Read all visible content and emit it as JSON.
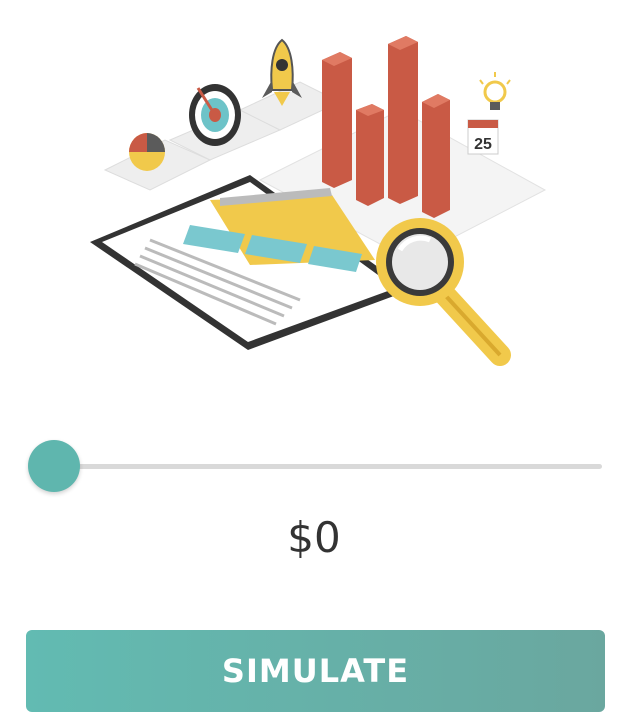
{
  "illustration": {
    "icon": "analytics-illustration",
    "calendar_day": "25"
  },
  "slider": {
    "value": 0,
    "min": 0
  },
  "amount_display": "$0",
  "simulate_button_label": "SIMULATE",
  "colors": {
    "accent": "#5fb6ae",
    "track": "#d9d9d9",
    "button_start": "#62bbb2",
    "button_end": "#6aa79f",
    "text": "#333333"
  }
}
